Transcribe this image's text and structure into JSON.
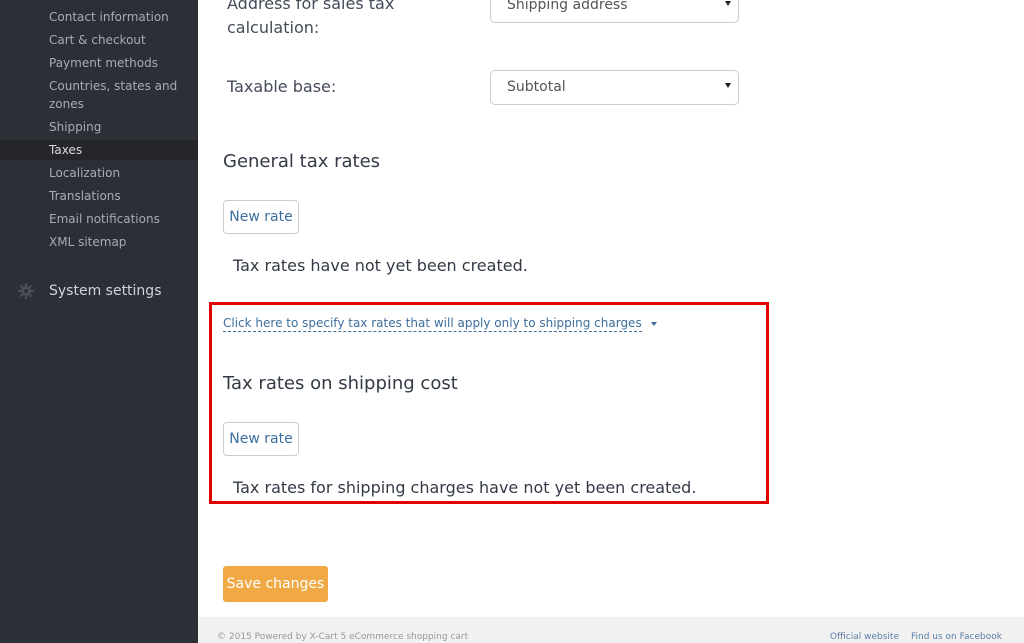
{
  "sidebar": {
    "items": [
      {
        "label": "Contact information"
      },
      {
        "label": "Cart & checkout"
      },
      {
        "label": "Payment methods"
      },
      {
        "label": "Countries, states and zones"
      },
      {
        "label": "Shipping"
      },
      {
        "label": "Taxes",
        "active": true
      },
      {
        "label": "Localization"
      },
      {
        "label": "Translations"
      },
      {
        "label": "Email notifications"
      },
      {
        "label": "XML sitemap"
      }
    ],
    "system_settings": {
      "label": "System settings",
      "icon": "gear-icon"
    }
  },
  "form": {
    "address_label": "Address for sales tax calculation:",
    "address_value": "Shipping address",
    "taxable_base_label": "Taxable base:",
    "taxable_base_value": "Subtotal"
  },
  "general_rates": {
    "title": "General tax rates",
    "new_rate_label": "New rate",
    "empty_message": "Tax rates have not yet been created."
  },
  "shipping_rates": {
    "toggle_link": "Click here to specify tax rates that will apply only to shipping charges",
    "title": "Tax rates on shipping cost",
    "new_rate_label": "New rate",
    "empty_message": "Tax rates for shipping charges have not yet been created."
  },
  "save_label": "Save changes",
  "footer": {
    "copyright": "© 2015 Powered by X-Cart 5 eCommerce shopping cart",
    "official_website": "Official website",
    "facebook": "Find us on Facebook"
  },
  "colors": {
    "sidebar_bg": "#2d2f37",
    "accent_link": "#3d6e9d",
    "save_button": "#f0a944",
    "highlight_box": "#e10000"
  }
}
